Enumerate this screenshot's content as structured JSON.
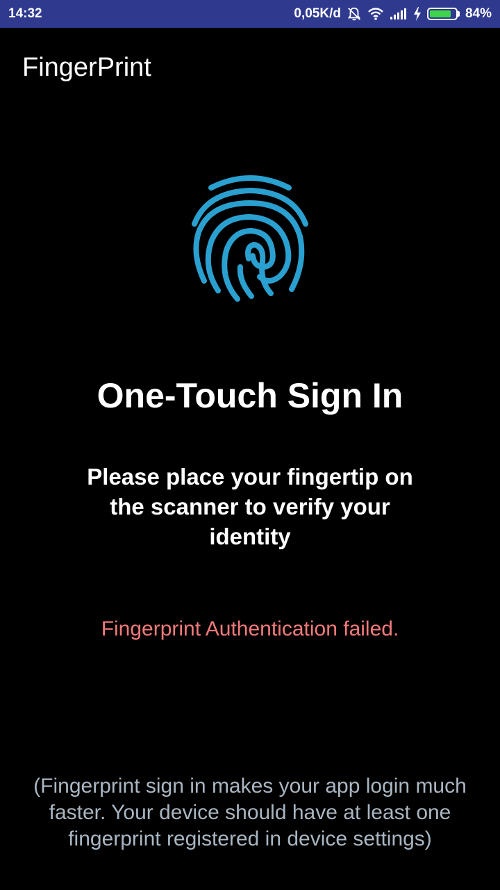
{
  "status_bar": {
    "time": "14:32",
    "network_speed": "0,05K/d",
    "battery_percent": "84%",
    "battery_level": 0.84,
    "icons": [
      "mute-bell-icon",
      "wifi-icon",
      "signal-icon",
      "charging-icon",
      "battery-icon"
    ],
    "background_color": "#2f3a8f"
  },
  "app_bar": {
    "title": "FingerPrint"
  },
  "main": {
    "icon": "fingerprint-icon",
    "icon_color": "#2aa0d0",
    "heading": "One-Touch Sign In",
    "instruction": "Please place your fingertip on the scanner to verify your identity",
    "error": "Fingerprint Authentication failed.",
    "error_color": "#f07a7a",
    "footnote": "(Fingerprint sign in makes your app login much faster. Your device should have at least one fingerprint registered in device settings)"
  }
}
